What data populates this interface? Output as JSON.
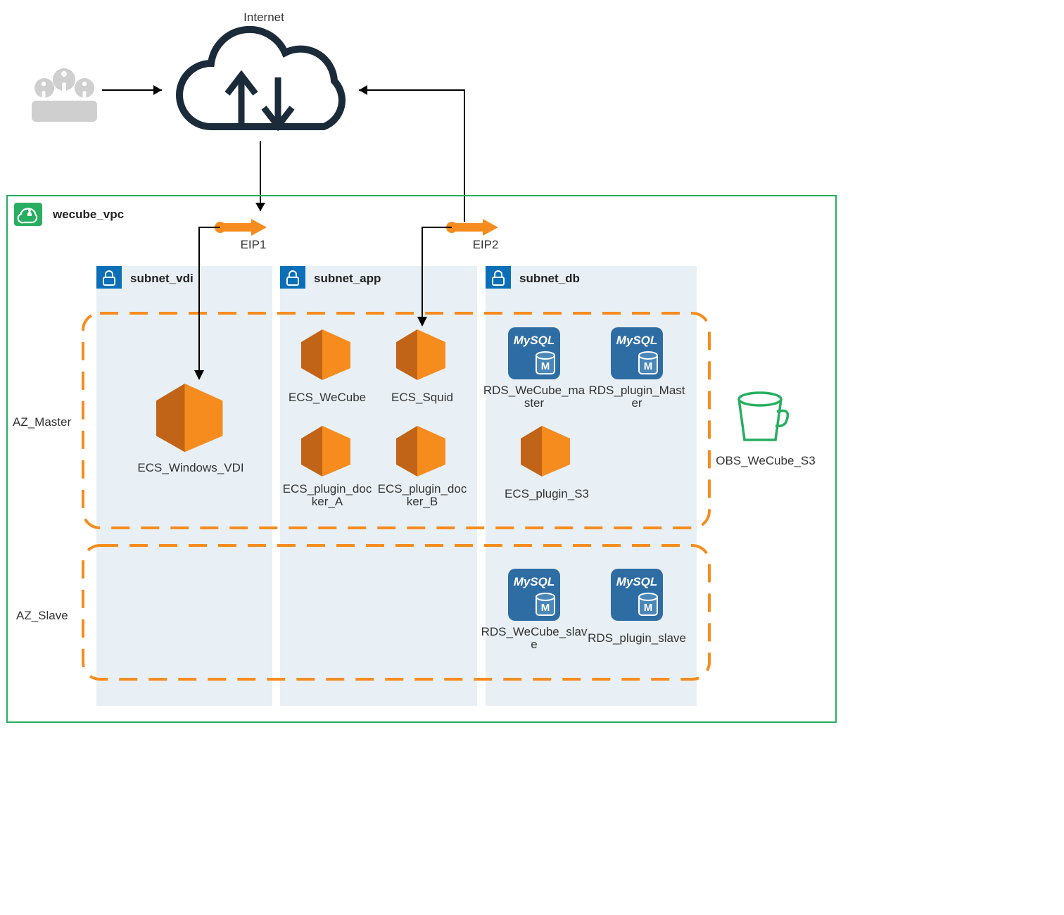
{
  "internet_label": "Internet",
  "vpc_label": "wecube_vpc",
  "eip1_label": "EIP1",
  "eip2_label": "EIP2",
  "subnet_vdi_label": "subnet_vdi",
  "subnet_app_label": "subnet_app",
  "subnet_db_label": "subnet_db",
  "az_master_label": "AZ_Master",
  "az_slave_label": "AZ_Slave",
  "ecs_windows_vdi_label": "ECS_Windows_VDI",
  "ecs_wecube_label": "ECS_WeCube",
  "ecs_squid_label": "ECS_Squid",
  "ecs_plugin_docker_a_label": "ECS_plugin_docker_A",
  "ecs_plugin_docker_b_label": "ECS_plugin_docker_B",
  "ecs_plugin_s3_label": "ECS_plugin_S3",
  "rds_wecube_master_label": "RDS_WeCube_master",
  "rds_plugin_master_label": "RDS_plugin_Master",
  "rds_wecube_slave_label": "RDS_WeCube_slave",
  "rds_plugin_slave_label": "RDS_plugin_slave",
  "obs_label": "OBS_WeCube_S3",
  "mysql_text": "MySQL"
}
